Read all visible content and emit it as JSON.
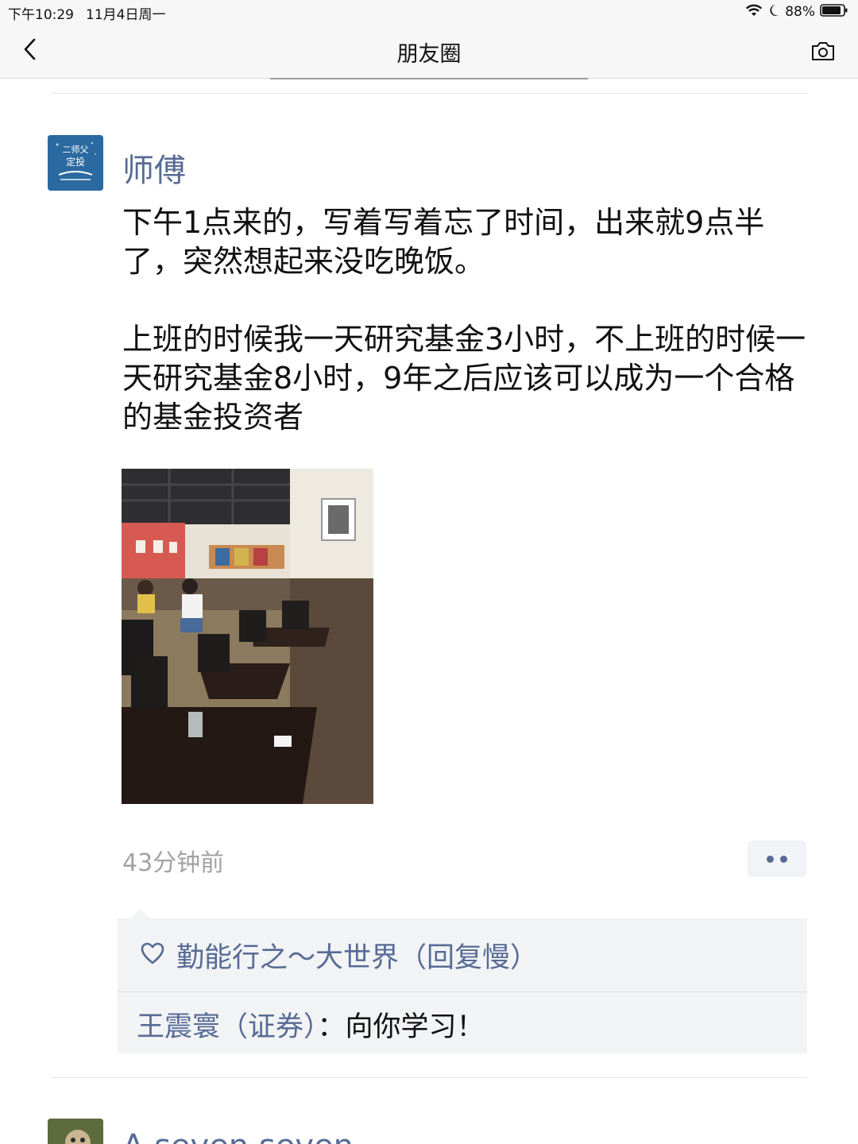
{
  "status_bar": {
    "time": "下午10:29",
    "date": "11月4日周一",
    "battery": "88%"
  },
  "nav": {
    "title": "朋友圈",
    "back_icon": "chevron-left-icon",
    "camera_icon": "camera-icon"
  },
  "post": {
    "author": "师傅",
    "avatar_text": "二师父 定投",
    "paragraphs": [
      "下午1点来的，写着写着忘了时间，出来就9点半了，突然想起来没吃晚饭。",
      "上班的时候我一天研究基金3小时，不上班的时候一天研究基金8小时，9年之后应该可以成为一个合格的基金投资者"
    ],
    "timestamp": "43分钟前",
    "likes": "勤能行之～大世界（回复慢）",
    "comments": [
      {
        "author": "王震寰（证券）",
        "separator": "：",
        "text": "向你学习！"
      }
    ]
  },
  "next_post": {
    "author": "A seven seven"
  },
  "colors": {
    "link_blue": "#576b95",
    "bar_bg": "#f7f7f7",
    "interaction_bg": "#f2f3f5"
  }
}
